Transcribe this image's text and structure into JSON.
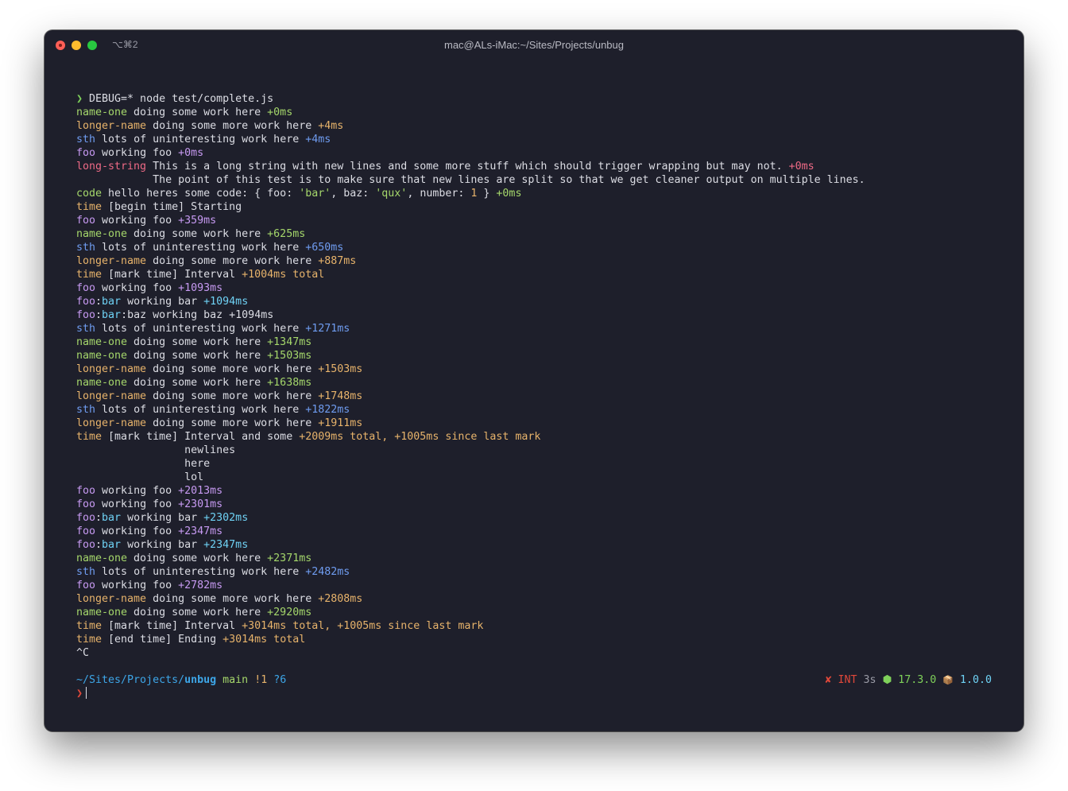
{
  "window": {
    "shortcut": "⌥⌘2",
    "title": "mac@ALs-iMac:~/Sites/Projects/unbug"
  },
  "colors": {
    "background": "#1e1f2b",
    "default_text": "#dcdde4",
    "name_one": "#a5d76b",
    "longer_name": "#e7b36b",
    "sth": "#6f9cf0",
    "foo": "#c79af2",
    "foo_bar": "#6fd2f5",
    "long_string": "#ee6a86",
    "code": "#a5d76b",
    "time": "#e7b36b",
    "string_literal": "#a5d76b",
    "number_literal": "#e7b36b",
    "prompt_chevron": "#7fd15a",
    "path": "#3da6e8",
    "git_branch": "#a5d76b",
    "git_modified": "#e7b36b",
    "git_untracked": "#3da6e8",
    "error": "#e0483a",
    "node_version": "#7fd15a",
    "package_version": "#6fd2f5",
    "muted": "#9a9ba6"
  },
  "terminal_lines": [
    [
      {
        "t": "❯ ",
        "c": "prompt_chevron"
      },
      {
        "t": "DEBUG=* node test/complete.js"
      }
    ],
    [
      {
        "t": "name-one",
        "c": "name_one"
      },
      {
        "t": " doing some work here "
      },
      {
        "t": "+0ms",
        "c": "name_one"
      }
    ],
    [
      {
        "t": "longer-name",
        "c": "longer_name"
      },
      {
        "t": " doing some more work here "
      },
      {
        "t": "+4ms",
        "c": "longer_name"
      }
    ],
    [
      {
        "t": "sth",
        "c": "sth"
      },
      {
        "t": " lots of uninteresting work here "
      },
      {
        "t": "+4ms",
        "c": "sth"
      }
    ],
    [
      {
        "t": "foo",
        "c": "foo"
      },
      {
        "t": " working foo "
      },
      {
        "t": "+0ms",
        "c": "foo"
      }
    ],
    [
      {
        "t": "long-string",
        "c": "long_string"
      },
      {
        "t": " This is a long string with new lines and some more stuff which should trigger wrapping but may not. "
      },
      {
        "t": "+0ms",
        "c": "long_string"
      }
    ],
    [
      {
        "t": "            The point of this test is to make sure that new lines are split so that we get cleaner output on multiple lines."
      }
    ],
    [
      {
        "t": "code",
        "c": "code"
      },
      {
        "t": " hello heres some code: { foo: "
      },
      {
        "t": "'bar'",
        "c": "string_literal"
      },
      {
        "t": ", baz: "
      },
      {
        "t": "'qux'",
        "c": "string_literal"
      },
      {
        "t": ", number: "
      },
      {
        "t": "1",
        "c": "number_literal"
      },
      {
        "t": " } "
      },
      {
        "t": "+0ms",
        "c": "code"
      }
    ],
    [
      {
        "t": "time",
        "c": "time"
      },
      {
        "t": " [begin time] Starting"
      }
    ],
    [
      {
        "t": "foo",
        "c": "foo"
      },
      {
        "t": " working foo "
      },
      {
        "t": "+359ms",
        "c": "foo"
      }
    ],
    [
      {
        "t": "name-one",
        "c": "name_one"
      },
      {
        "t": " doing some work here "
      },
      {
        "t": "+625ms",
        "c": "name_one"
      }
    ],
    [
      {
        "t": "sth",
        "c": "sth"
      },
      {
        "t": " lots of uninteresting work here "
      },
      {
        "t": "+650ms",
        "c": "sth"
      }
    ],
    [
      {
        "t": "longer-name",
        "c": "longer_name"
      },
      {
        "t": " doing some more work here "
      },
      {
        "t": "+887ms",
        "c": "longer_name"
      }
    ],
    [
      {
        "t": "time",
        "c": "time"
      },
      {
        "t": " [mark time] Interval "
      },
      {
        "t": "+1004ms total",
        "c": "time"
      }
    ],
    [
      {
        "t": "foo",
        "c": "foo"
      },
      {
        "t": " working foo "
      },
      {
        "t": "+1093ms",
        "c": "foo"
      }
    ],
    [
      {
        "t": "foo",
        "c": "foo"
      },
      {
        "t": ":"
      },
      {
        "t": "bar",
        "c": "foo_bar"
      },
      {
        "t": " working bar "
      },
      {
        "t": "+1094ms",
        "c": "foo_bar"
      }
    ],
    [
      {
        "t": "foo",
        "c": "foo"
      },
      {
        "t": ":"
      },
      {
        "t": "bar",
        "c": "foo_bar"
      },
      {
        "t": ":baz working baz +1094ms"
      }
    ],
    [
      {
        "t": "sth",
        "c": "sth"
      },
      {
        "t": " lots of uninteresting work here "
      },
      {
        "t": "+1271ms",
        "c": "sth"
      }
    ],
    [
      {
        "t": "name-one",
        "c": "name_one"
      },
      {
        "t": " doing some work here "
      },
      {
        "t": "+1347ms",
        "c": "name_one"
      }
    ],
    [
      {
        "t": "name-one",
        "c": "name_one"
      },
      {
        "t": " doing some work here "
      },
      {
        "t": "+1503ms",
        "c": "name_one"
      }
    ],
    [
      {
        "t": "longer-name",
        "c": "longer_name"
      },
      {
        "t": " doing some more work here "
      },
      {
        "t": "+1503ms",
        "c": "longer_name"
      }
    ],
    [
      {
        "t": "name-one",
        "c": "name_one"
      },
      {
        "t": " doing some work here "
      },
      {
        "t": "+1638ms",
        "c": "name_one"
      }
    ],
    [
      {
        "t": "longer-name",
        "c": "longer_name"
      },
      {
        "t": " doing some more work here "
      },
      {
        "t": "+1748ms",
        "c": "longer_name"
      }
    ],
    [
      {
        "t": "sth",
        "c": "sth"
      },
      {
        "t": " lots of uninteresting work here "
      },
      {
        "t": "+1822ms",
        "c": "sth"
      }
    ],
    [
      {
        "t": "longer-name",
        "c": "longer_name"
      },
      {
        "t": " doing some more work here "
      },
      {
        "t": "+1911ms",
        "c": "longer_name"
      }
    ],
    [
      {
        "t": "time",
        "c": "time"
      },
      {
        "t": " [mark time] Interval and some "
      },
      {
        "t": "+2009ms total, +1005ms since last mark",
        "c": "time"
      }
    ],
    [
      {
        "t": "                 newlines"
      }
    ],
    [
      {
        "t": "                 here"
      }
    ],
    [
      {
        "t": "                 lol"
      }
    ],
    [
      {
        "t": "foo",
        "c": "foo"
      },
      {
        "t": " working foo "
      },
      {
        "t": "+2013ms",
        "c": "foo"
      }
    ],
    [
      {
        "t": "foo",
        "c": "foo"
      },
      {
        "t": " working foo "
      },
      {
        "t": "+2301ms",
        "c": "foo"
      }
    ],
    [
      {
        "t": "foo",
        "c": "foo"
      },
      {
        "t": ":"
      },
      {
        "t": "bar",
        "c": "foo_bar"
      },
      {
        "t": " working bar "
      },
      {
        "t": "+2302ms",
        "c": "foo_bar"
      }
    ],
    [
      {
        "t": "foo",
        "c": "foo"
      },
      {
        "t": " working foo "
      },
      {
        "t": "+2347ms",
        "c": "foo"
      }
    ],
    [
      {
        "t": "foo",
        "c": "foo"
      },
      {
        "t": ":"
      },
      {
        "t": "bar",
        "c": "foo_bar"
      },
      {
        "t": " working bar "
      },
      {
        "t": "+2347ms",
        "c": "foo_bar"
      }
    ],
    [
      {
        "t": "name-one",
        "c": "name_one"
      },
      {
        "t": " doing some work here "
      },
      {
        "t": "+2371ms",
        "c": "name_one"
      }
    ],
    [
      {
        "t": "sth",
        "c": "sth"
      },
      {
        "t": " lots of uninteresting work here "
      },
      {
        "t": "+2482ms",
        "c": "sth"
      }
    ],
    [
      {
        "t": "foo",
        "c": "foo"
      },
      {
        "t": " working foo "
      },
      {
        "t": "+2782ms",
        "c": "foo"
      }
    ],
    [
      {
        "t": "longer-name",
        "c": "longer_name"
      },
      {
        "t": " doing some more work here "
      },
      {
        "t": "+2808ms",
        "c": "longer_name"
      }
    ],
    [
      {
        "t": "name-one",
        "c": "name_one"
      },
      {
        "t": " doing some work here "
      },
      {
        "t": "+2920ms",
        "c": "name_one"
      }
    ],
    [
      {
        "t": "time",
        "c": "time"
      },
      {
        "t": " [mark time] Interval "
      },
      {
        "t": "+3014ms total, +1005ms since last mark",
        "c": "time"
      }
    ],
    [
      {
        "t": "time",
        "c": "time"
      },
      {
        "t": " [end time] Ending "
      },
      {
        "t": "+3014ms total",
        "c": "time"
      }
    ],
    [
      {
        "t": "^C"
      }
    ]
  ],
  "prompt": {
    "path_prefix": "~/Sites/Projects/",
    "path_current": "unbug",
    "git_branch": "main",
    "git_modified": "!1",
    "git_untracked": "?6",
    "status_error_icon": "✘",
    "status_signal": "INT",
    "status_duration": "3s",
    "node_icon": "⬢",
    "node_version": "17.3.0",
    "package_icon": "📦",
    "package_version": "1.0.0",
    "input_chevron": "❯"
  }
}
